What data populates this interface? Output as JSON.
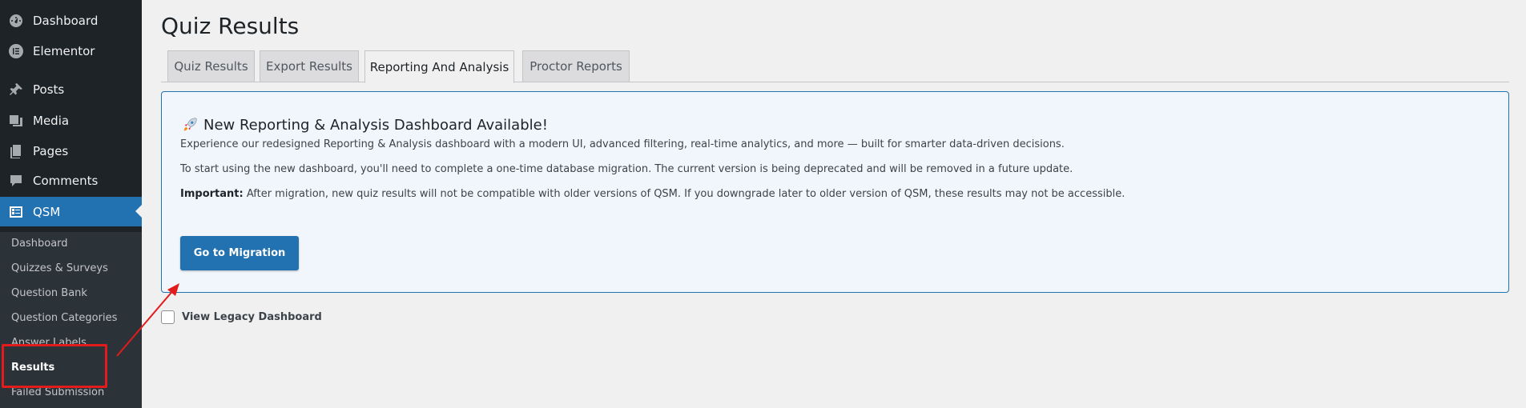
{
  "sidebar": {
    "menu": [
      {
        "label": "Dashboard",
        "icon": "dashboard-icon"
      },
      {
        "label": "Elementor",
        "icon": "elementor-icon"
      },
      {
        "label": "Posts",
        "icon": "pin-icon"
      },
      {
        "label": "Media",
        "icon": "media-icon"
      },
      {
        "label": "Pages",
        "icon": "pages-icon"
      },
      {
        "label": "Comments",
        "icon": "comments-icon"
      },
      {
        "label": "QSM",
        "icon": "qsm-icon"
      }
    ],
    "submenu": [
      {
        "label": "Dashboard"
      },
      {
        "label": "Quizzes & Surveys"
      },
      {
        "label": "Question Bank"
      },
      {
        "label": "Question Categories"
      },
      {
        "label": "Answer Labels"
      },
      {
        "label": "Results"
      },
      {
        "label": "Failed Submission"
      }
    ]
  },
  "page": {
    "title": "Quiz Results",
    "tabs": [
      {
        "label": "Quiz Results"
      },
      {
        "label": "Export Results"
      },
      {
        "label": "Reporting And Analysis"
      },
      {
        "label": "Proctor Reports"
      }
    ],
    "active_tab": "Reporting And Analysis"
  },
  "notice": {
    "heading": "New Reporting & Analysis Dashboard Available!",
    "p1": "Experience our redesigned Reporting & Analysis dashboard with a modern UI, advanced filtering, real-time analytics, and more — built for smarter data-driven decisions.",
    "p2": "To start using the new dashboard, you'll need to complete a one-time database migration. The current version is being deprecated and will be removed in a future update.",
    "p3_strong": "Important:",
    "p3": " After migration, new quiz results will not be compatible with older versions of QSM. If you downgrade later to older version of QSM, these results may not be accessible.",
    "button": "Go to Migration"
  },
  "legacy": {
    "label": "View Legacy Dashboard",
    "checked": false
  },
  "colors": {
    "accent": "#2271b1",
    "sidebar_bg": "#1d2327",
    "annotation": "#e21c1c"
  }
}
